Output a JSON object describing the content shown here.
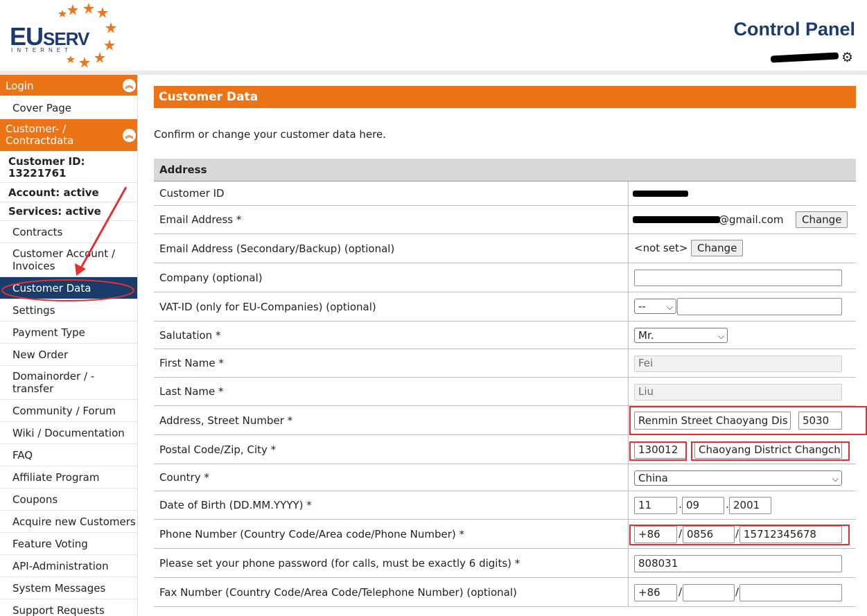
{
  "header": {
    "logo_main": "EU",
    "logo_small": "SERV",
    "logo_sub": "INTERNET",
    "title": "Control Panel",
    "settings_icon": "gear-icon"
  },
  "sidebar": {
    "login_label": "Login",
    "cover_page": "Cover Page",
    "customer_section": "Customer- / Contractdata",
    "collapse_icon": "chevron-up-icon",
    "customer_id": "Customer ID: 13221761",
    "account_status": "Account: active",
    "services_status": "Services: active",
    "items": [
      "Contracts",
      "Customer Account / Invoices",
      "Customer Data",
      "Settings",
      "Payment Type",
      "New Order",
      "Domainorder / - transfer",
      "Community / Forum",
      "Wiki / Documentation",
      "FAQ",
      "Affiliate Program",
      "Coupons",
      "Acquire new Customers",
      "Feature Voting",
      "API-Administration",
      "System Messages",
      "Support Requests"
    ]
  },
  "main": {
    "title": "Customer Data",
    "intro": "Confirm or change your customer data here.",
    "section": "Address",
    "labels": {
      "customer_id": "Customer ID",
      "email": "Email Address *",
      "email_secondary": "Email Address (Secondary/Backup) (optional)",
      "company": "Company (optional)",
      "vat": "VAT-ID (only for EU-Companies) (optional)",
      "salutation": "Salutation *",
      "first_name": "First Name *",
      "last_name": "Last Name *",
      "street": "Address, Street Number *",
      "postal_city": "Postal Code/Zip, City *",
      "country": "Country *",
      "dob": "Date of Birth (DD.MM.YYYY) *",
      "phone": "Phone Number (Country Code/Area code/Phone Number) *",
      "phone_password": "Please set your phone password (for calls, must be exactly 6 digits) *",
      "fax": "Fax Number (Country Code/Area Code/Telephone Number) (optional)"
    },
    "values": {
      "email_visible": "@gmail.com",
      "change_button": "Change",
      "secondary_not_set": "<not set>",
      "company": "",
      "vat_select": "--",
      "vat_id": "",
      "salutation": "Mr.",
      "first_name": "Fei",
      "last_name": "Liu",
      "street": "Renmin Street Chaoyang Dis",
      "street_number": "5030",
      "postal_code": "130012",
      "city": "Chaoyang District Changch",
      "country": "China",
      "dob_day": "11",
      "dob_month": "09",
      "dob_year": "2001",
      "phone_country": "+86",
      "phone_area": "0856",
      "phone_number": "15712345678",
      "phone_password": "808031",
      "fax_country": "+86",
      "fax_area": "",
      "fax_number": ""
    },
    "separators": {
      "slash": "/",
      "dot": "."
    }
  },
  "colors": {
    "accent_orange": "#ec7316",
    "nav_active": "#1a3c6b",
    "brand_blue": "#1c3c6e",
    "annotation_red": "#e03030"
  }
}
